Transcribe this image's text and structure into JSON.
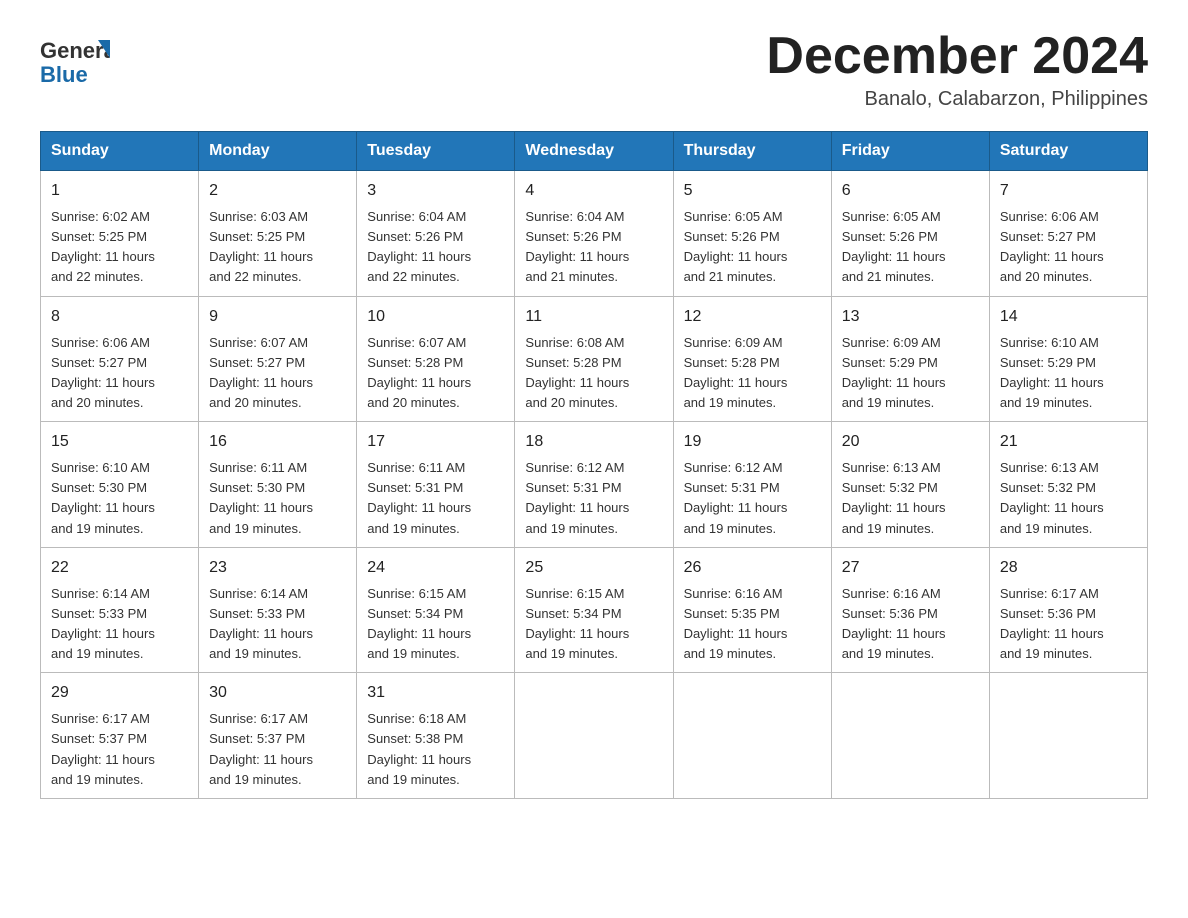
{
  "header": {
    "logo_general": "General",
    "logo_blue": "Blue",
    "month_title": "December 2024",
    "location": "Banalo, Calabarzon, Philippines"
  },
  "weekdays": [
    "Sunday",
    "Monday",
    "Tuesday",
    "Wednesday",
    "Thursday",
    "Friday",
    "Saturday"
  ],
  "weeks": [
    [
      {
        "day": "1",
        "sunrise": "6:02 AM",
        "sunset": "5:25 PM",
        "daylight": "11 hours and 22 minutes."
      },
      {
        "day": "2",
        "sunrise": "6:03 AM",
        "sunset": "5:25 PM",
        "daylight": "11 hours and 22 minutes."
      },
      {
        "day": "3",
        "sunrise": "6:04 AM",
        "sunset": "5:26 PM",
        "daylight": "11 hours and 22 minutes."
      },
      {
        "day": "4",
        "sunrise": "6:04 AM",
        "sunset": "5:26 PM",
        "daylight": "11 hours and 21 minutes."
      },
      {
        "day": "5",
        "sunrise": "6:05 AM",
        "sunset": "5:26 PM",
        "daylight": "11 hours and 21 minutes."
      },
      {
        "day": "6",
        "sunrise": "6:05 AM",
        "sunset": "5:26 PM",
        "daylight": "11 hours and 21 minutes."
      },
      {
        "day": "7",
        "sunrise": "6:06 AM",
        "sunset": "5:27 PM",
        "daylight": "11 hours and 20 minutes."
      }
    ],
    [
      {
        "day": "8",
        "sunrise": "6:06 AM",
        "sunset": "5:27 PM",
        "daylight": "11 hours and 20 minutes."
      },
      {
        "day": "9",
        "sunrise": "6:07 AM",
        "sunset": "5:27 PM",
        "daylight": "11 hours and 20 minutes."
      },
      {
        "day": "10",
        "sunrise": "6:07 AM",
        "sunset": "5:28 PM",
        "daylight": "11 hours and 20 minutes."
      },
      {
        "day": "11",
        "sunrise": "6:08 AM",
        "sunset": "5:28 PM",
        "daylight": "11 hours and 20 minutes."
      },
      {
        "day": "12",
        "sunrise": "6:09 AM",
        "sunset": "5:28 PM",
        "daylight": "11 hours and 19 minutes."
      },
      {
        "day": "13",
        "sunrise": "6:09 AM",
        "sunset": "5:29 PM",
        "daylight": "11 hours and 19 minutes."
      },
      {
        "day": "14",
        "sunrise": "6:10 AM",
        "sunset": "5:29 PM",
        "daylight": "11 hours and 19 minutes."
      }
    ],
    [
      {
        "day": "15",
        "sunrise": "6:10 AM",
        "sunset": "5:30 PM",
        "daylight": "11 hours and 19 minutes."
      },
      {
        "day": "16",
        "sunrise": "6:11 AM",
        "sunset": "5:30 PM",
        "daylight": "11 hours and 19 minutes."
      },
      {
        "day": "17",
        "sunrise": "6:11 AM",
        "sunset": "5:31 PM",
        "daylight": "11 hours and 19 minutes."
      },
      {
        "day": "18",
        "sunrise": "6:12 AM",
        "sunset": "5:31 PM",
        "daylight": "11 hours and 19 minutes."
      },
      {
        "day": "19",
        "sunrise": "6:12 AM",
        "sunset": "5:31 PM",
        "daylight": "11 hours and 19 minutes."
      },
      {
        "day": "20",
        "sunrise": "6:13 AM",
        "sunset": "5:32 PM",
        "daylight": "11 hours and 19 minutes."
      },
      {
        "day": "21",
        "sunrise": "6:13 AM",
        "sunset": "5:32 PM",
        "daylight": "11 hours and 19 minutes."
      }
    ],
    [
      {
        "day": "22",
        "sunrise": "6:14 AM",
        "sunset": "5:33 PM",
        "daylight": "11 hours and 19 minutes."
      },
      {
        "day": "23",
        "sunrise": "6:14 AM",
        "sunset": "5:33 PM",
        "daylight": "11 hours and 19 minutes."
      },
      {
        "day": "24",
        "sunrise": "6:15 AM",
        "sunset": "5:34 PM",
        "daylight": "11 hours and 19 minutes."
      },
      {
        "day": "25",
        "sunrise": "6:15 AM",
        "sunset": "5:34 PM",
        "daylight": "11 hours and 19 minutes."
      },
      {
        "day": "26",
        "sunrise": "6:16 AM",
        "sunset": "5:35 PM",
        "daylight": "11 hours and 19 minutes."
      },
      {
        "day": "27",
        "sunrise": "6:16 AM",
        "sunset": "5:36 PM",
        "daylight": "11 hours and 19 minutes."
      },
      {
        "day": "28",
        "sunrise": "6:17 AM",
        "sunset": "5:36 PM",
        "daylight": "11 hours and 19 minutes."
      }
    ],
    [
      {
        "day": "29",
        "sunrise": "6:17 AM",
        "sunset": "5:37 PM",
        "daylight": "11 hours and 19 minutes."
      },
      {
        "day": "30",
        "sunrise": "6:17 AM",
        "sunset": "5:37 PM",
        "daylight": "11 hours and 19 minutes."
      },
      {
        "day": "31",
        "sunrise": "6:18 AM",
        "sunset": "5:38 PM",
        "daylight": "11 hours and 19 minutes."
      },
      null,
      null,
      null,
      null
    ]
  ],
  "labels": {
    "sunrise": "Sunrise:",
    "sunset": "Sunset:",
    "daylight": "Daylight:"
  }
}
